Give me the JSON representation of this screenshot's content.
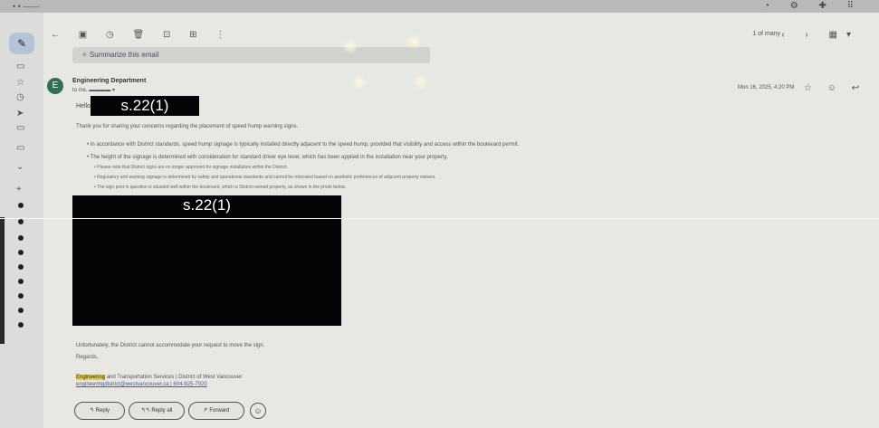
{
  "browser": {
    "tab_strip": "• •  ——",
    "controls": "◔ ⚙ ✚ ⠿"
  },
  "toolbar": {
    "back": "←",
    "actions": "▣ ◷ 🗑 ⊡ ⊞ ⋮",
    "pager": "1 of many",
    "nav": "‹ › ▦▾"
  },
  "rail": {
    "compose_icon": "✎"
  },
  "summarize": {
    "label": "✧ Summarize this email"
  },
  "message": {
    "avatar_letter": "E",
    "sender": "Engineering Department",
    "to": "to me, ▬▬▬▬ ▾",
    "date": "Mon 16, 2025, 4:20 PM",
    "actions": "☆ ☺ ↩",
    "greeting": "Hello",
    "redaction_label": "s.22(1)",
    "intro": "Thank you for sharing your concerns regarding the placement of speed hump warning signs.",
    "bullet1": "• In accordance with District standards, speed hump signage is typically installed directly adjacent to the speed hump, provided that visibility and access within the boulevard permit.",
    "bullet2": "• The height of the signage is determined with consideration for standard driver eye level, which has been applied in the installation near your property.",
    "sub_bullets": [
      "• Please note that District signs are no longer approved for signage installation within the District.",
      "• Regulatory and warning signage is determined by safety and operational standards and cannot be relocated based on aesthetic preferences of adjacent property owners.",
      "• The sign post in question is situated well within the boulevard, which is District-owned property, as shown in the photo below."
    ],
    "image_redaction_label": "s.22(1)",
    "closing": "Unfortunately, the District cannot accommodate your request to move the sign.",
    "regards": "Regards,",
    "sig_highlight": "Engineering",
    "sig_line1_rest": " and Transportation Services | District of West Vancouver",
    "sig_line2": "engineeringdistrict@westvancouver.ca | 604-925-7020"
  },
  "reply_buttons": {
    "reply": "↰ Reply",
    "reply_all": "↰↰ Reply all",
    "forward": "↱ Forward",
    "emoji": "☺"
  }
}
